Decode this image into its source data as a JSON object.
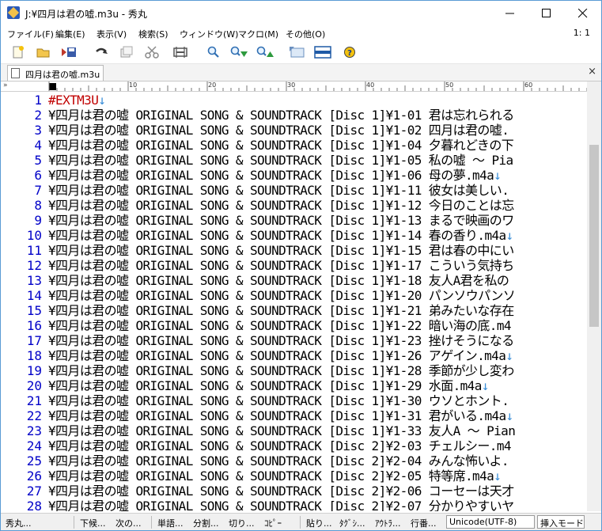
{
  "window": {
    "title": "J:¥四月は君の嘘.m3u  - 秀丸"
  },
  "menu": {
    "items": [
      "ファイル(F)",
      "編集(E)",
      "表示(V)",
      "検索(S)",
      "ウィンドウ(W)",
      "マクロ(M)",
      "その他(O)"
    ],
    "cursor_pos": "1: 1"
  },
  "toolbar": {
    "icons": [
      "new-file-icon",
      "open-folder-icon",
      "save-icon",
      "undo-icon",
      "copy-icon",
      "cut-icon",
      "paste-icon",
      "search-icon",
      "search-down-icon",
      "search-up-icon",
      "screen-icon",
      "window-icon",
      "help-icon"
    ]
  },
  "tab": {
    "label": "四月は君の嘘.m3u",
    "close": "×"
  },
  "ruler": {
    "chevron": "»",
    "marks": [
      "10",
      "20",
      "30",
      "40",
      "50",
      "60"
    ]
  },
  "editor": {
    "lines": [
      {
        "n": "1",
        "text": "#EXTM3U↓"
      },
      {
        "n": "2",
        "text": "¥四月は君の嘘 ORIGINAL SONG & SOUNDTRACK [Disc 1]¥1-01 君は忘れられる"
      },
      {
        "n": "3",
        "text": "¥四月は君の嘘 ORIGINAL SONG & SOUNDTRACK [Disc 1]¥1-02 四月は君の嘘."
      },
      {
        "n": "4",
        "text": "¥四月は君の嘘 ORIGINAL SONG & SOUNDTRACK [Disc 1]¥1-04 夕暮れどきの下"
      },
      {
        "n": "5",
        "text": "¥四月は君の嘘 ORIGINAL SONG & SOUNDTRACK [Disc 1]¥1-05 私の嘘 ～ Pia"
      },
      {
        "n": "6",
        "text": "¥四月は君の嘘 ORIGINAL SONG & SOUNDTRACK [Disc 1]¥1-06 母の夢.m4a↓"
      },
      {
        "n": "7",
        "text": "¥四月は君の嘘 ORIGINAL SONG & SOUNDTRACK [Disc 1]¥1-11 彼女は美しい."
      },
      {
        "n": "8",
        "text": "¥四月は君の嘘 ORIGINAL SONG & SOUNDTRACK [Disc 1]¥1-12 今日のことは忘"
      },
      {
        "n": "9",
        "text": "¥四月は君の嘘 ORIGINAL SONG & SOUNDTRACK [Disc 1]¥1-13 まるで映画のワ"
      },
      {
        "n": "10",
        "text": "¥四月は君の嘘 ORIGINAL SONG & SOUNDTRACK [Disc 1]¥1-14 春の香り.m4a↓"
      },
      {
        "n": "11",
        "text": "¥四月は君の嘘 ORIGINAL SONG & SOUNDTRACK [Disc 1]¥1-15 君は春の中にい"
      },
      {
        "n": "12",
        "text": "¥四月は君の嘘 ORIGINAL SONG & SOUNDTRACK [Disc 1]¥1-17 こういう気持ち"
      },
      {
        "n": "13",
        "text": "¥四月は君の嘘 ORIGINAL SONG & SOUNDTRACK [Disc 1]¥1-18 友人A君を私の"
      },
      {
        "n": "14",
        "text": "¥四月は君の嘘 ORIGINAL SONG & SOUNDTRACK [Disc 1]¥1-20 パンソウパンソ"
      },
      {
        "n": "15",
        "text": "¥四月は君の嘘 ORIGINAL SONG & SOUNDTRACK [Disc 1]¥1-21 弟みたいな存在"
      },
      {
        "n": "16",
        "text": "¥四月は君の嘘 ORIGINAL SONG & SOUNDTRACK [Disc 1]¥1-22 暗い海の底.m4"
      },
      {
        "n": "17",
        "text": "¥四月は君の嘘 ORIGINAL SONG & SOUNDTRACK [Disc 1]¥1-23 挫けそうになる"
      },
      {
        "n": "18",
        "text": "¥四月は君の嘘 ORIGINAL SONG & SOUNDTRACK [Disc 1]¥1-26 アゲイン.m4a↓"
      },
      {
        "n": "19",
        "text": "¥四月は君の嘘 ORIGINAL SONG & SOUNDTRACK [Disc 1]¥1-28 季節が少し変わ"
      },
      {
        "n": "20",
        "text": "¥四月は君の嘘 ORIGINAL SONG & SOUNDTRACK [Disc 1]¥1-29 水面.m4a↓"
      },
      {
        "n": "21",
        "text": "¥四月は君の嘘 ORIGINAL SONG & SOUNDTRACK [Disc 1]¥1-30 ウソとホント."
      },
      {
        "n": "22",
        "text": "¥四月は君の嘘 ORIGINAL SONG & SOUNDTRACK [Disc 1]¥1-31 君がいる.m4a↓"
      },
      {
        "n": "23",
        "text": "¥四月は君の嘘 ORIGINAL SONG & SOUNDTRACK [Disc 1]¥1-33 友人A ～ Pian"
      },
      {
        "n": "24",
        "text": "¥四月は君の嘘 ORIGINAL SONG & SOUNDTRACK [Disc 2]¥2-03 チェルシー.m4"
      },
      {
        "n": "25",
        "text": "¥四月は君の嘘 ORIGINAL SONG & SOUNDTRACK [Disc 2]¥2-04 みんな怖いよ."
      },
      {
        "n": "26",
        "text": "¥四月は君の嘘 ORIGINAL SONG & SOUNDTRACK [Disc 2]¥2-05 特等席.m4a↓"
      },
      {
        "n": "27",
        "text": "¥四月は君の嘘 ORIGINAL SONG & SOUNDTRACK [Disc 2]¥2-06 コーセーは天才"
      },
      {
        "n": "28",
        "text": "¥四月は君の嘘 ORIGINAL SONG & SOUNDTRACK [Disc 2]¥2-07 分かりやすいヤ"
      }
    ]
  },
  "status": {
    "items": [
      "秀丸...",
      "下候...",
      "次の...",
      "単語...",
      "分割...",
      "切り...",
      "ｺﾋﾟｰ",
      "貼り...",
      "ﾀｸﾞｼ...",
      "ｱｳﾄﾗ...",
      "行番..."
    ],
    "encoding": "Unicode(UTF-8)",
    "mode": "挿入モード"
  }
}
